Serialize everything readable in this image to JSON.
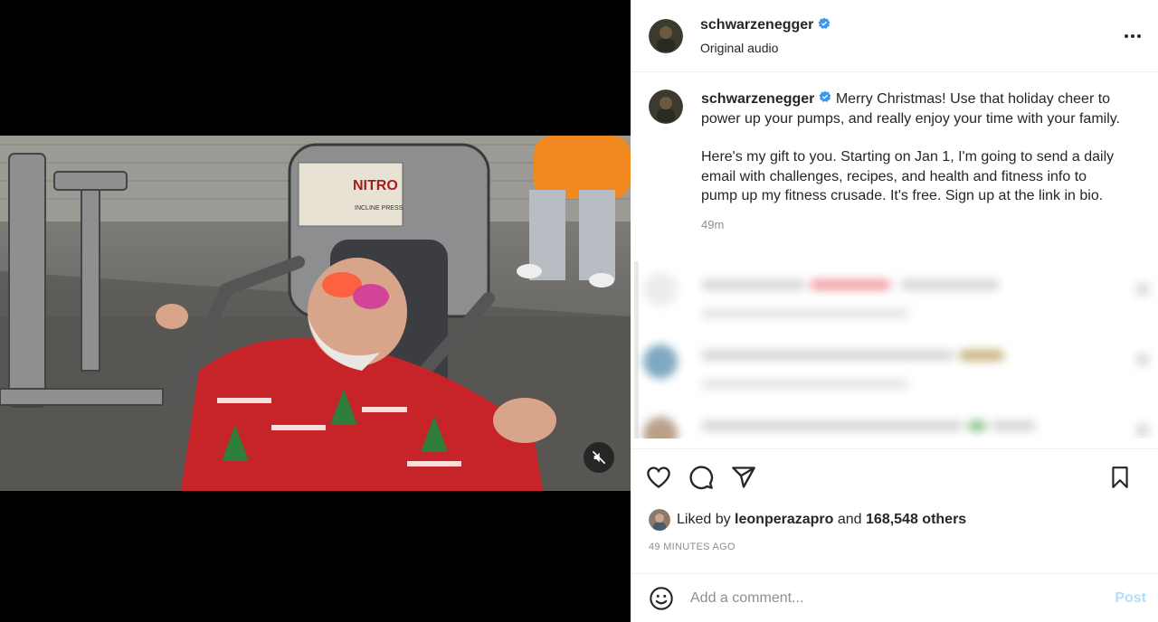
{
  "post": {
    "username": "schwarzenegger",
    "audio_label": "Original audio",
    "caption_p1": "Merry Christmas! Use that holiday cheer to power up your pumps, and really enjoy your time with your family.",
    "caption_p2": "Here's my gift to you. Starting on Jan 1, I'm going to send a daily email with challenges, recipes, and health and fitness info to pump up my fitness crusade. It's free. Sign up at the link in bio.",
    "caption_age": "49m",
    "liked_by_prefix": "Liked by",
    "liked_by_user": "leonperazapro",
    "liked_by_and": "and",
    "liked_by_others": "168,548 others",
    "timestamp": "49 MINUTES AGO"
  },
  "comment_box": {
    "placeholder": "Add a comment...",
    "post_label": "Post"
  },
  "icons": {
    "verified": "verified-badge-icon",
    "more": "more-options-icon",
    "like": "heart-icon",
    "comment": "comment-bubble-icon",
    "share": "paper-plane-icon",
    "save": "bookmark-icon",
    "emoji": "emoji-icon",
    "mute": "muted-speaker-icon"
  },
  "colors": {
    "verified_blue": "#3897f0",
    "post_button_disabled": "#b2dffc",
    "secondary_text": "#8e8e8e"
  }
}
